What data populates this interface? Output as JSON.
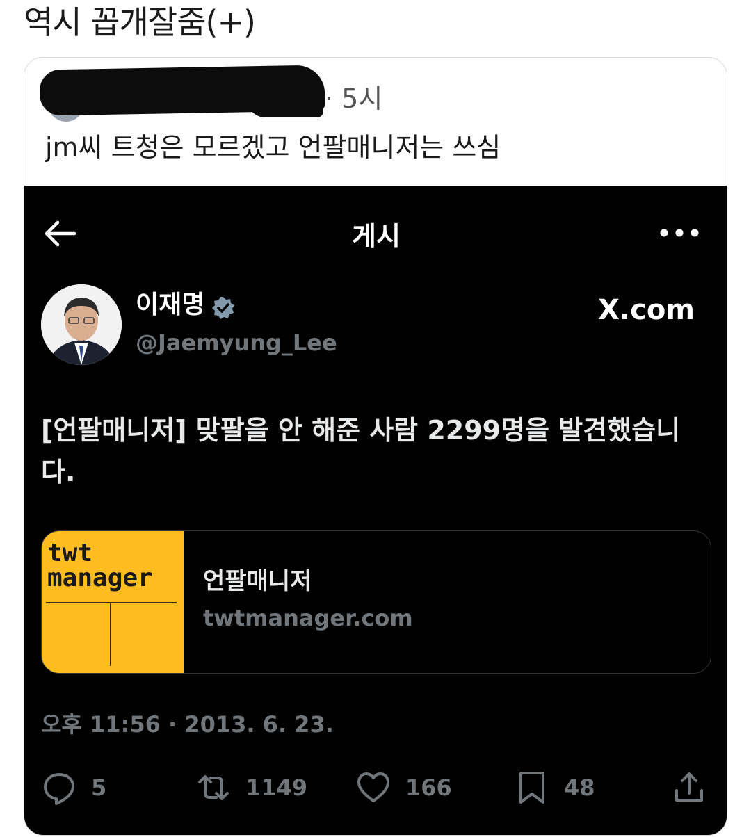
{
  "post": {
    "title": "역시 꼽개잘줌(+)"
  },
  "comment": {
    "time": "· 5시",
    "text": "jm씨 트청은 모르겠고 언팔매니저는 쓰심"
  },
  "screenshot": {
    "header_title": "게시",
    "user": {
      "name": "이재명",
      "handle": "@Jaemyung_Lee"
    },
    "brand": "X.com",
    "tweet_text": "[언팔매니저] 맞팔을 안 해준 사람 2299명을 발견했습니다.",
    "link_card": {
      "thumb_line1": "twt",
      "thumb_line2": "manager",
      "title": "언팔매니저",
      "domain": "twtmanager.com"
    },
    "timestamp": "오후 11:56 · 2013. 6. 23.",
    "actions": {
      "replies": "5",
      "retweets": "1149",
      "likes": "166",
      "bookmarks": "48"
    }
  },
  "icons": [
    "back-arrow-icon",
    "more-icon",
    "verified-icon",
    "reply-icon",
    "retweet-icon",
    "like-icon",
    "bookmark-icon",
    "share-icon"
  ],
  "colors": {
    "background": "#000000",
    "muted": "#71767b",
    "thumb_yellow": "#fdbd1e",
    "verified": "#829aab"
  }
}
